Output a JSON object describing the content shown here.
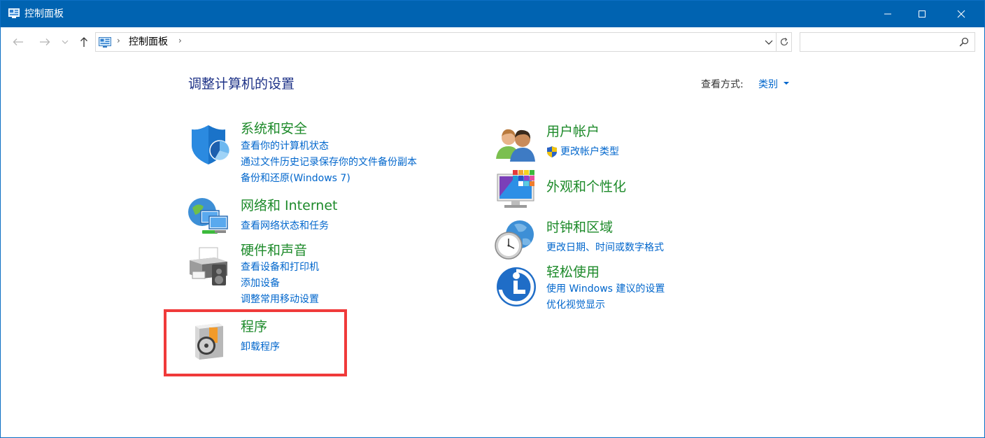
{
  "window": {
    "title": "控制面板"
  },
  "address_bar": {
    "crumb": "控制面板",
    "separator": "›"
  },
  "search": {
    "placeholder": "",
    "value": ""
  },
  "main": {
    "heading": "调整计算机的设置",
    "view_by_label": "查看方式:",
    "view_by_value": "类别"
  },
  "categories": {
    "system_security": {
      "title": "系统和安全",
      "links": [
        "查看你的计算机状态",
        "通过文件历史记录保存你的文件备份副本",
        "备份和还原(Windows 7)"
      ],
      "icon": "shield-icon"
    },
    "network": {
      "title": "网络和 Internet",
      "links": [
        "查看网络状态和任务"
      ],
      "icon": "network-globe-icon"
    },
    "hardware": {
      "title": "硬件和声音",
      "links": [
        "查看设备和打印机",
        "添加设备",
        "调整常用移动设置"
      ],
      "icon": "printer-icon"
    },
    "programs": {
      "title": "程序",
      "links": [
        "卸载程序"
      ],
      "icon": "programs-disc-icon"
    },
    "user_accounts": {
      "title": "用户帐户",
      "links": [
        "更改帐户类型"
      ],
      "icon": "users-icon"
    },
    "appearance": {
      "title": "外观和个性化",
      "links": [],
      "icon": "monitor-palette-icon"
    },
    "clock_region": {
      "title": "时钟和区域",
      "links": [
        "更改日期、时间或数字格式"
      ],
      "icon": "clock-globe-icon"
    },
    "ease_of_access": {
      "title": "轻松使用",
      "links": [
        "使用 Windows 建议的设置",
        "优化视觉显示"
      ],
      "icon": "ease-of-access-icon"
    }
  },
  "colors": {
    "titlebar": "#0063b1",
    "category_title": "#1d8a2a",
    "link": "#0066cc",
    "heading": "#1e3287",
    "highlight_box": "#f03a3a"
  }
}
